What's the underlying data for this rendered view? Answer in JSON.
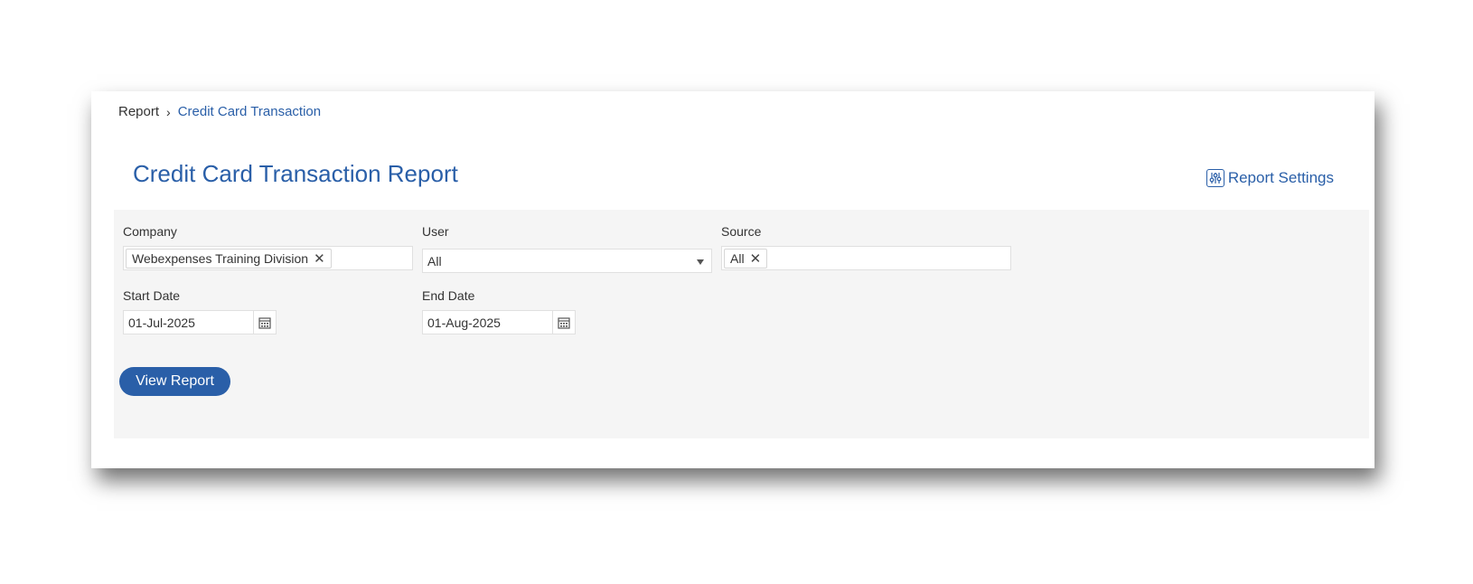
{
  "breadcrumb": {
    "root": "Report",
    "separator": "›",
    "current": "Credit Card Transaction"
  },
  "page": {
    "title": "Credit Card Transaction Report",
    "settings_label": "Report Settings",
    "settings_icon": "sliders-icon"
  },
  "filters": {
    "company": {
      "label": "Company",
      "chips": [
        "Webexpenses Training Division"
      ]
    },
    "user": {
      "label": "User",
      "value": "All"
    },
    "source": {
      "label": "Source",
      "chips": [
        "All"
      ]
    },
    "start_date": {
      "label": "Start Date",
      "value": "01-Jul-2025"
    },
    "end_date": {
      "label": "End Date",
      "value": "01-Aug-2025"
    }
  },
  "actions": {
    "view_report": "View Report"
  },
  "colors": {
    "accent": "#2a5fa8",
    "panel_bg": "#f5f5f5"
  }
}
